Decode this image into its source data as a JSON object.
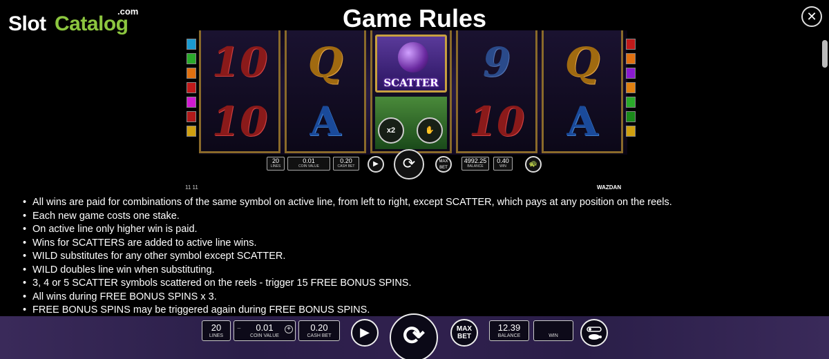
{
  "logo": {
    "slot": "Slot",
    "catalog": "Catalog",
    "com": ".com"
  },
  "title": "Game Rules",
  "close_glyph": "✕",
  "preview": {
    "reel1": [
      "10",
      "10"
    ],
    "reel2": [
      "Q",
      "A"
    ],
    "scatter_label": "SCATTER",
    "reel4": [
      "9",
      "10"
    ],
    "reel5": [
      "Q",
      "A"
    ],
    "x2_label": "x2",
    "mini_bar": {
      "lines_value": "20",
      "lines_label": "LINES",
      "coin_value": "0.01",
      "coin_label": "COIN VALUE",
      "cash_value": "0.20",
      "cash_label": "CASH BET",
      "max_label": "MAX BET",
      "balance_value": "4992.25",
      "balance_label": "BALANCE",
      "win_value": "0.40",
      "win_label": "WIN"
    },
    "footer_left": "11 11",
    "brand": "WAZDAN"
  },
  "rules": [
    "All wins are paid for combinations of the same symbol on active line, from left to right, except SCATTER, which pays at any position on the reels.",
    "Each new game costs one stake.",
    "On active line only higher win is paid.",
    "Wins for SCATTERS are added to active line wins.",
    "WILD substitutes for any other symbol except SCATTER.",
    "WILD doubles line win when substituting.",
    "3, 4 or 5 SCATTER symbols scattered on the reels - trigger 15 FREE BONUS SPINS.",
    "All wins during FREE BONUS SPINS x 3.",
    "FREE BONUS SPINS may be triggered again during FREE BONUS SPINS."
  ],
  "bottom_bar": {
    "lines_value": "20",
    "lines_label": "LINES",
    "coin_value": "0.01",
    "coin_label": "COIN VALUE",
    "minus": "−",
    "plus": "+",
    "cash_value": "0.20",
    "cash_label": "CASH BET",
    "max_label_1": "MAX",
    "max_label_2": "BET",
    "balance_value": "12.39",
    "balance_label": "BALANCE",
    "win_label": "WIN"
  },
  "icons": {
    "close": "close-icon",
    "play": "play-icon",
    "spin": "spin-icon",
    "turtle": "turtle-icon"
  },
  "colors": {
    "logo_green": "#8cc63f",
    "bar_purple": "#2a1e48"
  }
}
